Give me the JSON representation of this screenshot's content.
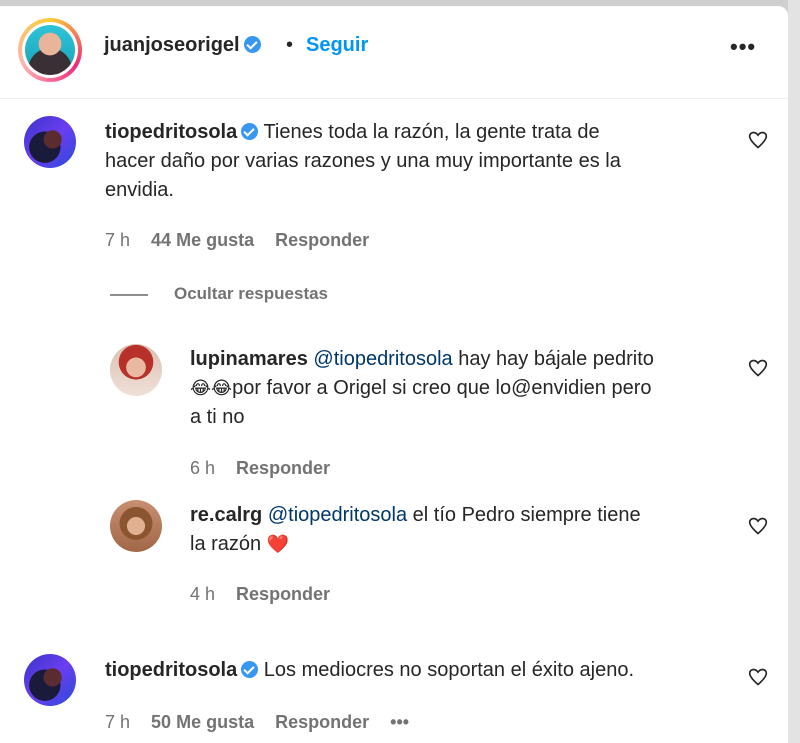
{
  "header": {
    "username": "juanjoseorigel",
    "separator": "•",
    "follow_label": "Seguir",
    "more_label": "•••"
  },
  "comments": [
    {
      "username": "tiopedritosola",
      "verified": true,
      "text_line1": "Tienes toda la razón, la gente trata de",
      "text_line2": "hacer daño por varias razones y una muy importante es la",
      "text_line3": "envidia.",
      "time": "7 h",
      "likes": "44 Me gusta",
      "reply_label": "Responder"
    },
    {
      "hide_replies_label": "Ocultar respuestas"
    },
    {
      "username": "lupinamares",
      "mention": "@tiopedritosola",
      "text_line1_rest": "hay hay bájale pedrito",
      "emoji": "😂😂",
      "text_line2_rest": "por favor a Origel si creo que lo@envidien pero",
      "text_line3": "a ti no",
      "time": "6 h",
      "reply_label": "Responder"
    },
    {
      "username": "re.calrg",
      "mention": "@tiopedritosola",
      "text_line1_rest": "el tío Pedro siempre tiene",
      "text_line2": "la razón",
      "heart_emoji": "❤️",
      "time": "4 h",
      "reply_label": "Responder"
    },
    {
      "username": "tiopedritosola",
      "verified": true,
      "text_line1": "Los mediocres no soportan el éxito ajeno.",
      "time": "7 h",
      "likes": "50 Me gusta",
      "reply_label": "Responder",
      "more_label": "•••"
    }
  ],
  "icons": {
    "heart": "heart-outline-icon",
    "verified": "verified-badge-icon",
    "more": "more-horizontal-icon"
  },
  "colors": {
    "link_blue": "#0095f6",
    "mention_blue": "#00376b",
    "verified_blue": "#3897f0",
    "meta_gray": "#737373"
  }
}
